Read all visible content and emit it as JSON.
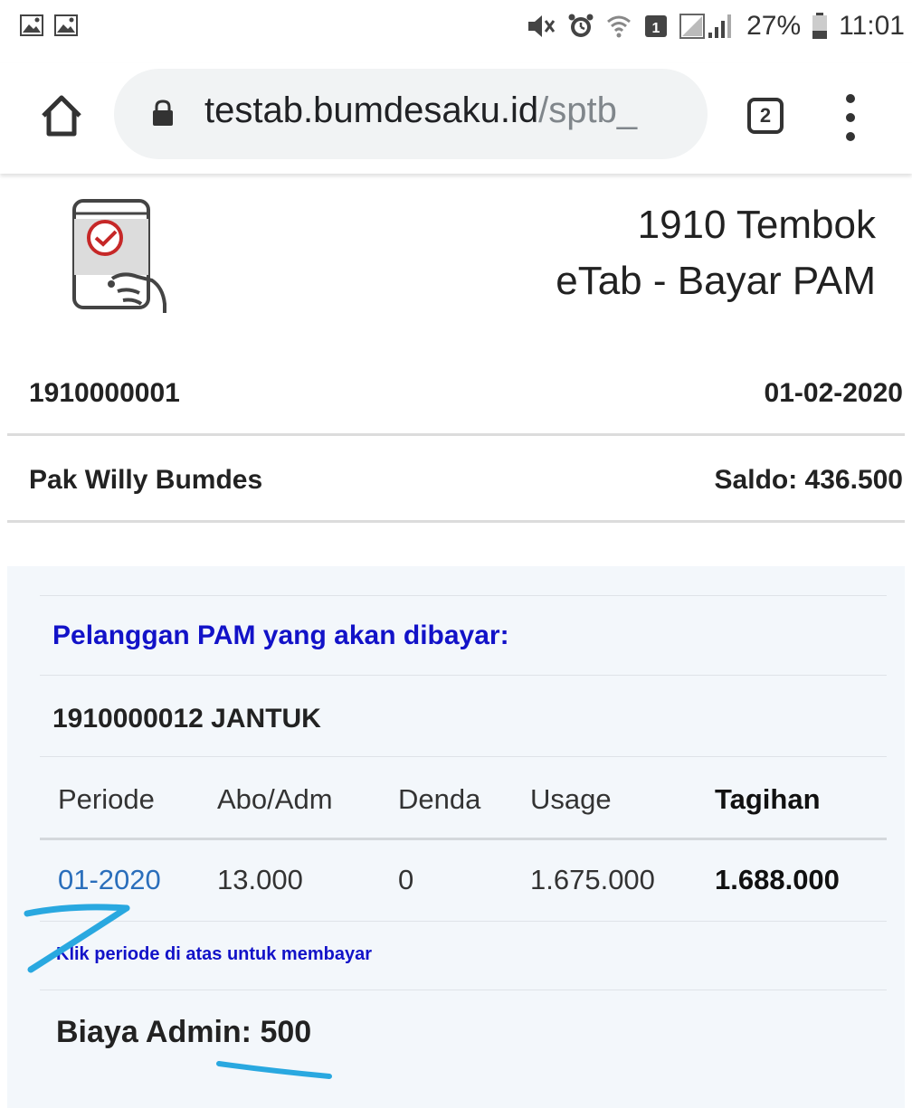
{
  "status_bar": {
    "battery_percent": "27%",
    "time": "11:01"
  },
  "browser": {
    "url_host": "testab.bumdesaku.id",
    "url_path": "/sptb_",
    "tab_count": "2"
  },
  "header": {
    "title_line1": "1910 Tembok",
    "title_line2": "eTab - Bayar PAM"
  },
  "account": {
    "id": "1910000001",
    "date": "01-02-2020",
    "name": "Pak Willy Bumdes",
    "balance": "Saldo: 436.500"
  },
  "payment": {
    "heading": "Pelanggan PAM yang akan dibayar:",
    "customer": "1910000012 JANTUK",
    "columns": [
      "Periode",
      "Abo/Adm",
      "Denda",
      "Usage",
      "Tagihan"
    ],
    "rows": [
      {
        "periode": "01-2020",
        "abo_adm": "13.000",
        "denda": "0",
        "usage": "1.675.000",
        "tagihan": "1.688.000"
      }
    ],
    "hint": "Klik periode di atas untuk membayar",
    "admin_fee": "Biaya Admin: 500"
  },
  "colors": {
    "heading_blue": "#1212c8",
    "link_blue": "#2a6ebb",
    "panel_bg": "#f3f7fb",
    "annotation_blue": "#29a8e0"
  }
}
